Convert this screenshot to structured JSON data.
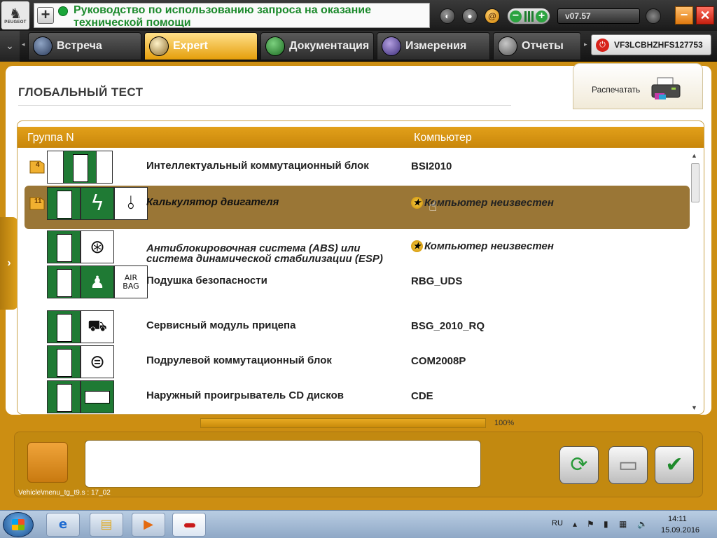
{
  "app": {
    "logo_text": "PEUGEOT",
    "notice": "Руководство по использованию запроса на оказание технической помощи",
    "version": "v07.57",
    "vin": "VF3LCBHZHFS127753"
  },
  "nav": {
    "tabs": [
      {
        "label": "Встреча",
        "icon": "meeting-icon"
      },
      {
        "label": "Expert",
        "icon": "magnifier-icon",
        "active": true
      },
      {
        "label": "Документация",
        "icon": "book-icon"
      },
      {
        "label": "Измерения",
        "icon": "waveform-icon"
      },
      {
        "label": "Отчеты",
        "icon": "report-icon"
      }
    ]
  },
  "page": {
    "title": "ГЛОБАЛЬНЫЙ ТЕСТ",
    "print_label": "Распечатать"
  },
  "table": {
    "headers": {
      "group": "Группа N",
      "computer": "Компьютер"
    },
    "rows": [
      {
        "flag": "4",
        "name": "Интеллектуальный коммутационный блок",
        "computer": "BSI2010",
        "italic": false,
        "selected": false
      },
      {
        "flag": "11",
        "name": "Калькулятор двигателя",
        "computer": "Компьютер неизвестен",
        "italic": true,
        "selected": true,
        "star": true
      },
      {
        "flag": "",
        "name": "Антиблокировочная система (ABS) или система динамической стабилизации (ESP)",
        "computer": "Компьютер неизвестен",
        "italic": true,
        "selected": false,
        "star": true
      },
      {
        "flag": "",
        "name": "Подушка безопасности",
        "computer": "RBG_UDS",
        "italic": false,
        "selected": false
      },
      {
        "flag": "",
        "name": "Сервисный модуль прицепа",
        "computer": "BSG_2010_RQ",
        "italic": false,
        "selected": false
      },
      {
        "flag": "",
        "name": "Подрулевой коммутационный блок",
        "computer": "COM2008P",
        "italic": false,
        "selected": false
      },
      {
        "flag": "",
        "name": "Наружный проигрыватель CD дисков",
        "computer": "CDE",
        "italic": false,
        "selected": false
      }
    ]
  },
  "progress": {
    "value": 1.0,
    "label": "100%"
  },
  "footer": {
    "path": "Vehicle\\menu_tg_t9.s : 17_02"
  },
  "taskbar": {
    "lang": "RU",
    "time": "14:11",
    "date": "15.09.2016"
  },
  "colors": {
    "accent": "#cc8e12",
    "selected_row": "#9a7636",
    "ecu_green": "#1f7a34"
  }
}
